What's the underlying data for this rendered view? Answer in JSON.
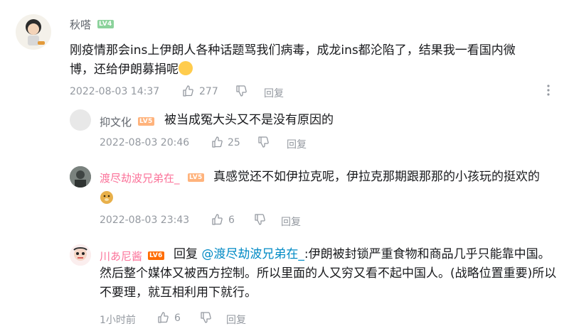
{
  "comments": [
    {
      "user": "秋嗒",
      "level": "LV4",
      "text": "刚疫情那会ins上伊朗人各种话题骂我们病毒，成龙ins都沦陷了，结果我一看国内微博，还给伊朗募捐呢",
      "time": "2022-08-03 14:37",
      "likes": "277",
      "reply_label": "回复"
    },
    {
      "user": "抑文化",
      "level": "LV5",
      "text": "被当成冤大头又不是没有原因的",
      "time": "2022-08-03 20:46",
      "likes": "25",
      "reply_label": "回复"
    },
    {
      "user": "渡尽劫波兄弟在_",
      "level": "LV5",
      "text": "真感觉还不如伊拉克呢，伊拉克那期跟那那的小孩玩的挺欢的",
      "time": "2022-08-03 23:43",
      "likes": "6",
      "reply_label": "回复"
    },
    {
      "user": "川あ尼酱",
      "level": "LV6",
      "reply_prefix": "回复",
      "mention": "@渡尽劫波兄弟在_",
      "text": ":伊朗被封锁严重食物和商品几乎只能靠中国。然后整个媒体又被西方控制。所以里面的人又穷又看不起中国人。(战略位置重要)所以不要理，就互相利用下就行。",
      "time": "1小时前",
      "likes": "6",
      "reply_label": "回复"
    }
  ],
  "icons": {
    "like": "thumb-up-icon",
    "dislike": "thumb-down-icon",
    "more": "more-vertical-icon"
  },
  "colors": {
    "lv4": "#8bd29b",
    "lv5": "#ffb37c",
    "lv6": "#ff6c00",
    "vip_name": "#fb7299",
    "mention": "#008ac5"
  }
}
